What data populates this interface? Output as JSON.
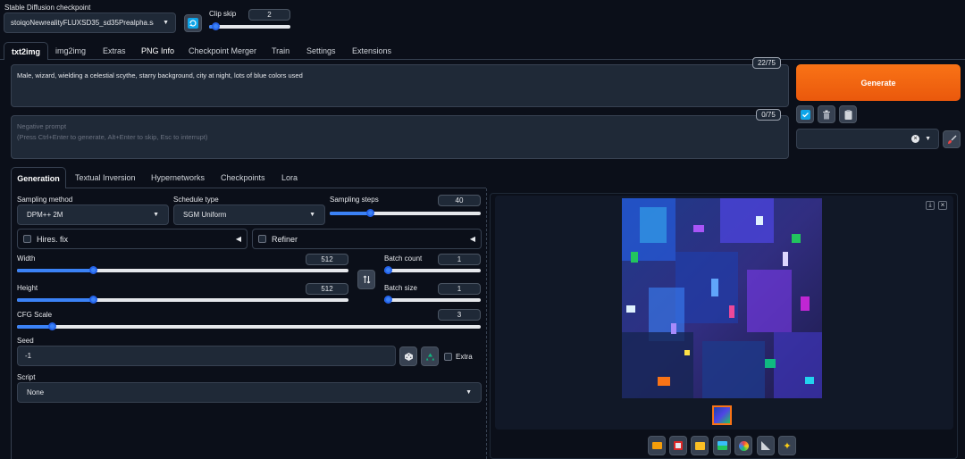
{
  "header": {
    "checkpoint_label": "Stable Diffusion checkpoint",
    "checkpoint_value": "stoiqoNewrealityFLUXSD35_sd35Prealpha.safet",
    "clip_skip_label": "Clip skip",
    "clip_skip_value": "2",
    "clip_skip_level": 0.08
  },
  "tabs": [
    "txt2img",
    "img2img",
    "Extras",
    "PNG Info",
    "Checkpoint Merger",
    "Train",
    "Settings",
    "Extensions"
  ],
  "prompt": {
    "text": "Male, wizard, wielding a celestial scythe, starry background, city at night, lots of blue colors used",
    "counter": "22/75"
  },
  "negative": {
    "placeholder": "Negative prompt",
    "hint": "(Press Ctrl+Enter to generate, Alt+Enter to skip, Esc to interrupt)",
    "counter": "0/75"
  },
  "generate_label": "Generate",
  "accent": "#f97316",
  "subtabs": [
    "Generation",
    "Textual Inversion",
    "Hypernetworks",
    "Checkpoints",
    "Lora"
  ],
  "gen": {
    "sampling_method_label": "Sampling method",
    "sampling_method_value": "DPM++ 2M",
    "schedule_type_label": "Schedule type",
    "schedule_type_value": "SGM Uniform",
    "sampling_steps_label": "Sampling steps",
    "sampling_steps_value": "40",
    "hires_label": "Hires. fix",
    "refiner_label": "Refiner",
    "width_label": "Width",
    "width_value": "512",
    "height_label": "Height",
    "height_value": "512",
    "batch_count_label": "Batch count",
    "batch_count_value": "1",
    "batch_size_label": "Batch size",
    "batch_size_value": "1",
    "cfg_label": "CFG Scale",
    "cfg_value": "3",
    "seed_label": "Seed",
    "seed_value": "-1",
    "extra_label": "Extra",
    "script_label": "Script",
    "script_value": "None"
  },
  "icons": {
    "refresh": "refresh-icon",
    "paste": "paste-icon",
    "trash": "trash-icon",
    "clipboard": "clipboard-icon",
    "brush": "brush-icon",
    "swap": "swap-icon",
    "dice": "dice-icon",
    "recycle": "recycle-icon"
  }
}
